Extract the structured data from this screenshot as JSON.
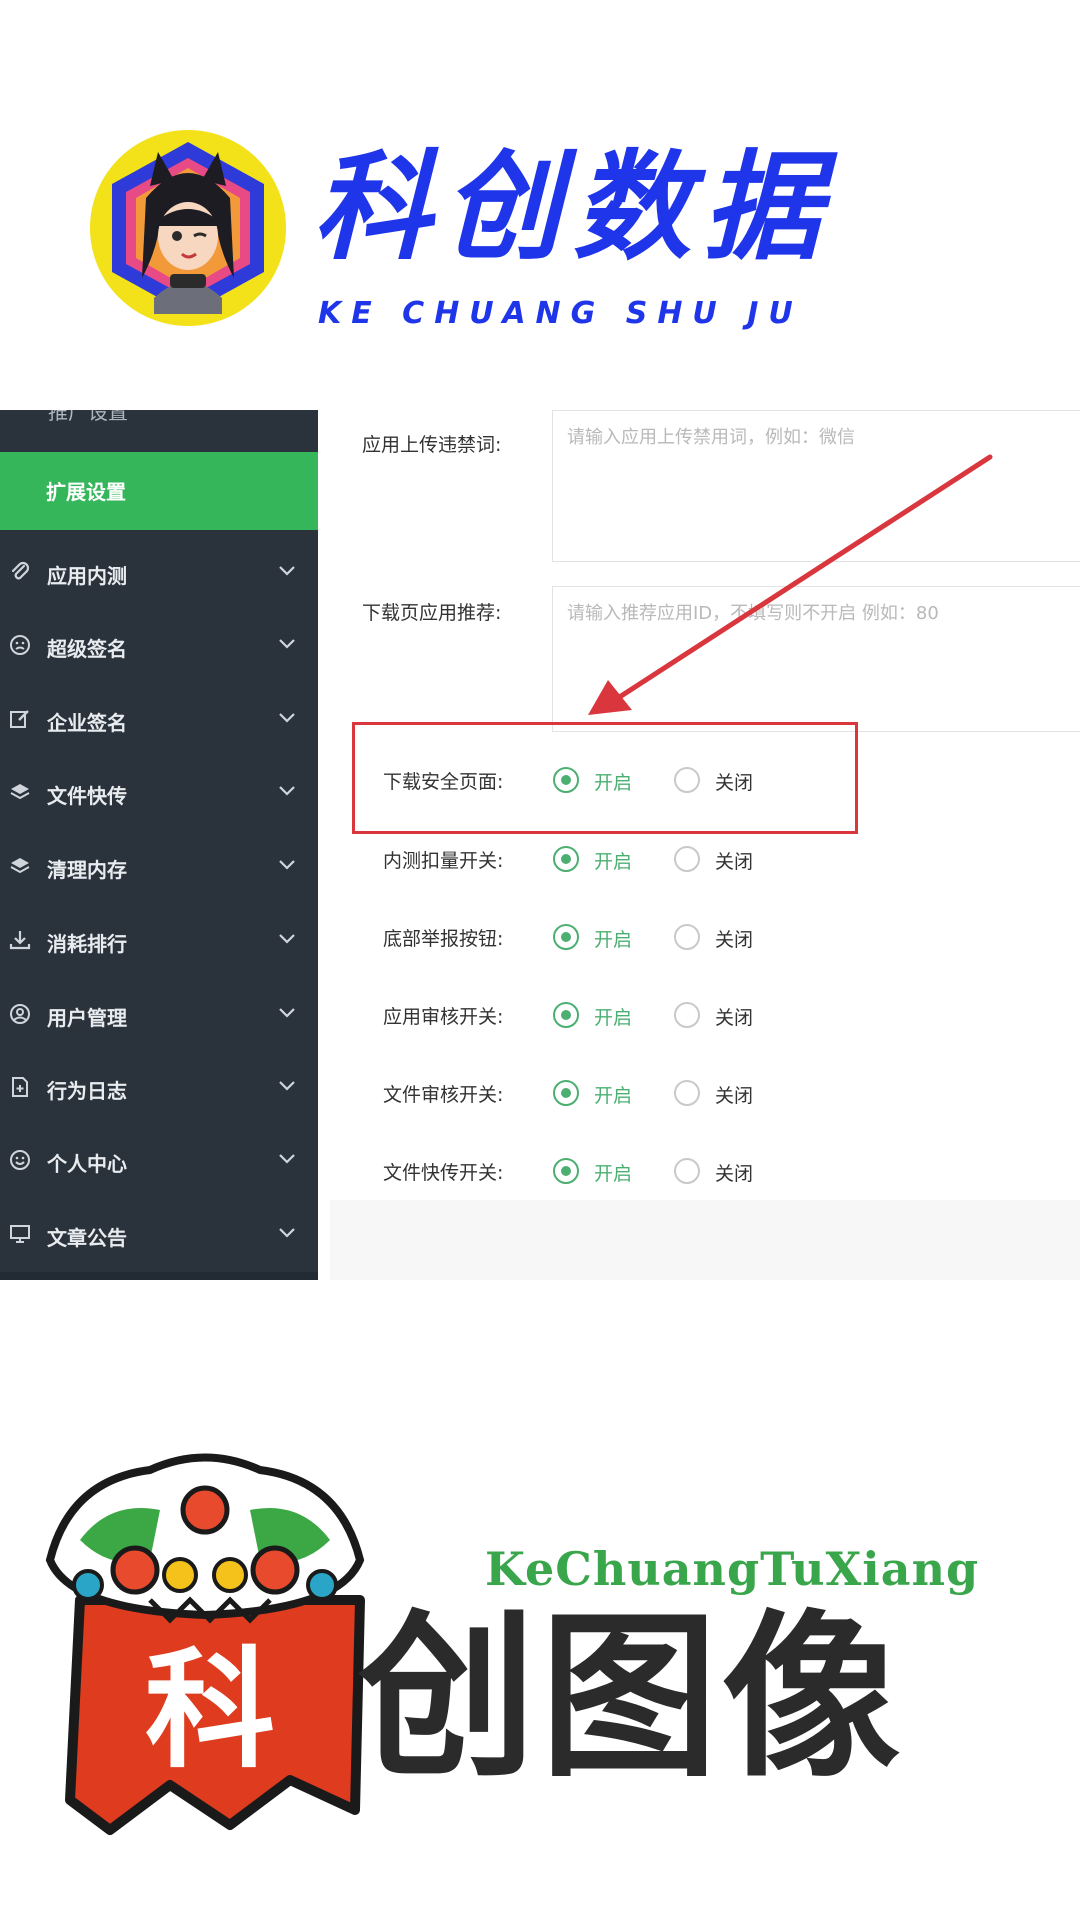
{
  "brand_top": {
    "name_cn": "科创数据",
    "name_en": "KE CHUANG SHU JU",
    "color": "#1f35ea"
  },
  "sidebar": {
    "cut_item": "推广设置",
    "active_item": "扩展设置",
    "accent": "#35b65a",
    "items": [
      {
        "label": "应用内测",
        "icon": "paperclip-icon"
      },
      {
        "label": "超级签名",
        "icon": "face-icon"
      },
      {
        "label": "企业签名",
        "icon": "edit-icon"
      },
      {
        "label": "文件快传",
        "icon": "layers-icon"
      },
      {
        "label": "清理内存",
        "icon": "layers-icon"
      },
      {
        "label": "消耗排行",
        "icon": "download-icon"
      },
      {
        "label": "用户管理",
        "icon": "user-circle-icon"
      },
      {
        "label": "行为日志",
        "icon": "file-plus-icon"
      },
      {
        "label": "个人中心",
        "icon": "smile-icon"
      },
      {
        "label": "文章公告",
        "icon": "monitor-icon"
      }
    ]
  },
  "form": {
    "upload_ban": {
      "label": "应用上传违禁词:",
      "placeholder": "请输入应用上传禁用词，例如：微信"
    },
    "recommend": {
      "label": "下载页应用推荐:",
      "placeholder": "请输入推荐应用ID，不填写则不开启 例如：80"
    },
    "on_text": "开启",
    "off_text": "关闭",
    "toggles": [
      {
        "label": "下载安全页面:",
        "value": "开启",
        "highlighted": true
      },
      {
        "label": "内测扣量开关:",
        "value": "开启"
      },
      {
        "label": "底部举报按钮:",
        "value": "开启"
      },
      {
        "label": "应用审核开关:",
        "value": "开启"
      },
      {
        "label": "文件审核开关:",
        "value": "开启"
      },
      {
        "label": "文件快传开关:",
        "value": "开启"
      }
    ],
    "accent": "#4caf72",
    "highlight_color": "#d9363e"
  },
  "brand_bottom": {
    "name_en": "KeChuangTuXiang",
    "name_cn": "创图像",
    "badge_char": "科",
    "en_color": "#3aa64c"
  }
}
